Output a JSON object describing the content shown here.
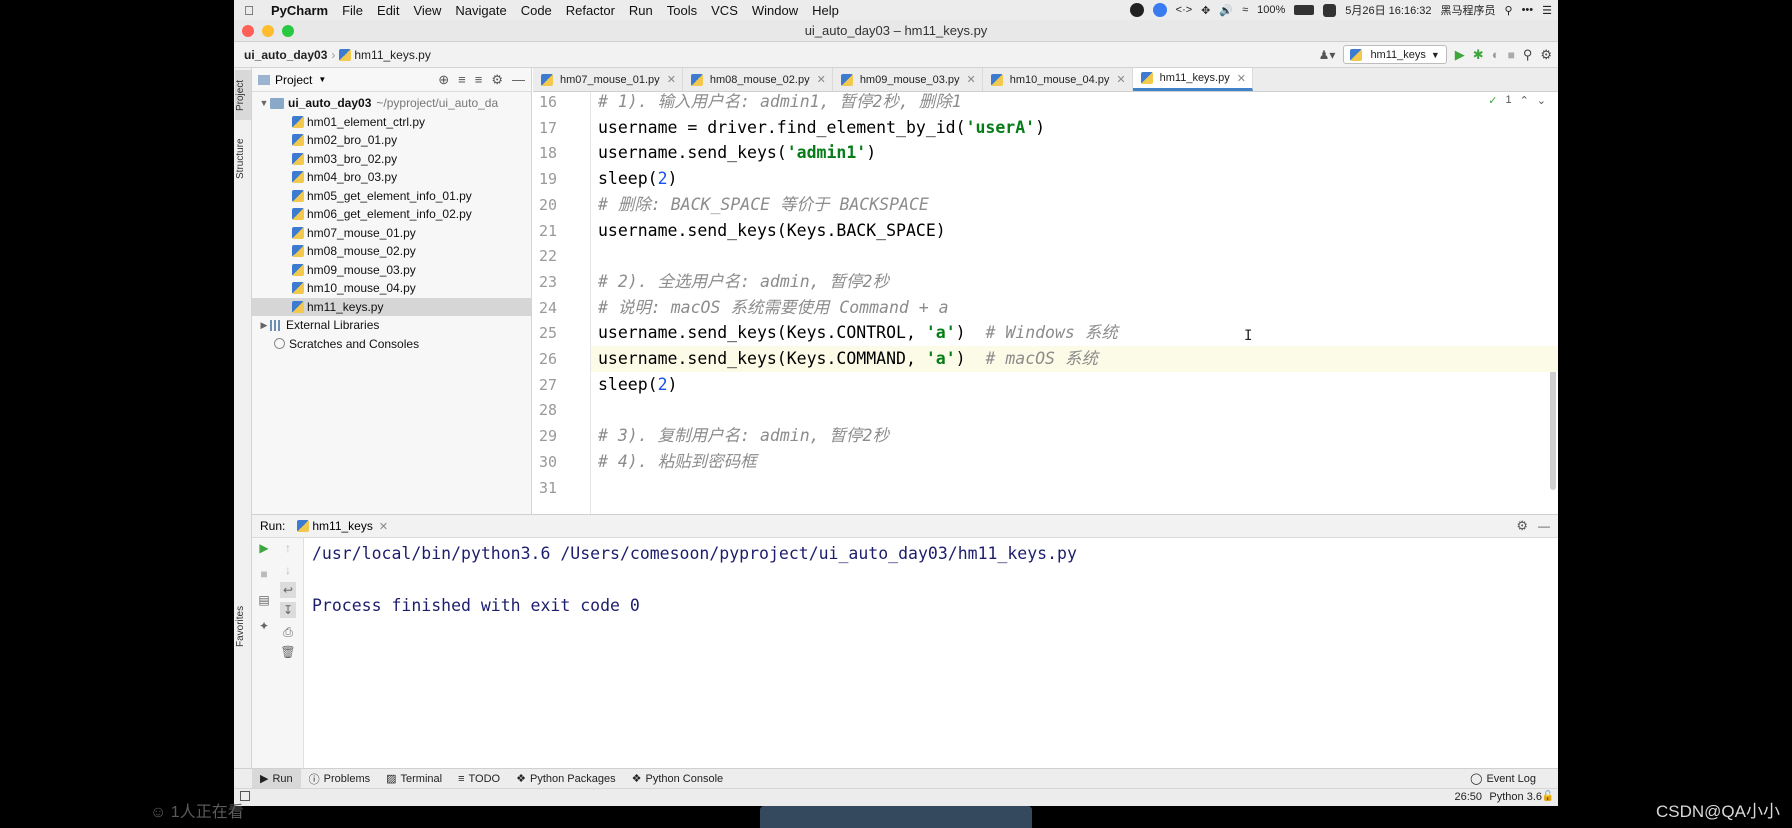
{
  "menubar": {
    "app_name": "PyCharm",
    "items": [
      "File",
      "Edit",
      "View",
      "Navigate",
      "Code",
      "Refactor",
      "Run",
      "Tools",
      "VCS",
      "Window",
      "Help"
    ],
    "battery": "100%",
    "clock": "5月26日 16:16:32",
    "user": "黑马程序员"
  },
  "window": {
    "title": "ui_auto_day03 – hm11_keys.py"
  },
  "navbar": {
    "project": "ui_auto_day03",
    "file": "hm11_keys.py",
    "run_config": "hm11_keys"
  },
  "project_panel": {
    "header": "Project",
    "side_tabs": {
      "project": "Project",
      "structure": "Structure",
      "favorites": "Favorites"
    },
    "root": {
      "name": "ui_auto_day03",
      "path": "~/pyproject/ui_auto_da"
    },
    "files": [
      "hm01_element_ctrl.py",
      "hm02_bro_01.py",
      "hm03_bro_02.py",
      "hm04_bro_03.py",
      "hm05_get_element_info_01.py",
      "hm06_get_element_info_02.py",
      "hm07_mouse_01.py",
      "hm08_mouse_02.py",
      "hm09_mouse_03.py",
      "hm10_mouse_04.py",
      "hm11_keys.py"
    ],
    "selected_file": "hm11_keys.py",
    "external_libraries": "External Libraries",
    "scratches": "Scratches and Consoles"
  },
  "editor": {
    "tabs": [
      "hm07_mouse_01.py",
      "hm08_mouse_02.py",
      "hm09_mouse_03.py",
      "hm10_mouse_04.py",
      "hm11_keys.py"
    ],
    "active_tab": "hm11_keys.py",
    "inspection_count": "1",
    "lines": [
      {
        "n": "16",
        "parts": [
          {
            "t": "# 1). 输入用户名: admin1, 暂停2秒, 删除1",
            "c": "cmt"
          }
        ]
      },
      {
        "n": "17",
        "parts": [
          {
            "t": "username = driver.find_element_by_id(",
            "c": ""
          },
          {
            "t": "'userA'",
            "c": "str"
          },
          {
            "t": ")",
            "c": ""
          }
        ]
      },
      {
        "n": "18",
        "parts": [
          {
            "t": "username.send_keys(",
            "c": ""
          },
          {
            "t": "'admin1'",
            "c": "str"
          },
          {
            "t": ")",
            "c": ""
          }
        ]
      },
      {
        "n": "19",
        "parts": [
          {
            "t": "sleep(",
            "c": ""
          },
          {
            "t": "2",
            "c": "num"
          },
          {
            "t": ")",
            "c": ""
          }
        ]
      },
      {
        "n": "20",
        "parts": [
          {
            "t": "# 删除: BACK_SPACE 等价于 BACKSPACE",
            "c": "cmt"
          }
        ]
      },
      {
        "n": "21",
        "parts": [
          {
            "t": "username.send_keys(Keys.BACK_SPACE)",
            "c": ""
          }
        ]
      },
      {
        "n": "22",
        "parts": []
      },
      {
        "n": "23",
        "parts": [
          {
            "t": "# 2). 全选用户名: admin, 暂停2秒",
            "c": "cmt"
          }
        ]
      },
      {
        "n": "24",
        "parts": [
          {
            "t": "# 说明: macOS 系统需要使用 Command + a",
            "c": "cmt"
          }
        ]
      },
      {
        "n": "25",
        "parts": [
          {
            "t": "username.send_keys(Keys.CONTROL, ",
            "c": ""
          },
          {
            "t": "'a'",
            "c": "str"
          },
          {
            "t": ")  ",
            "c": ""
          },
          {
            "t": "# Windows 系统",
            "c": "cmt"
          }
        ]
      },
      {
        "n": "26",
        "parts": [
          {
            "t": "username.send_keys(Keys.COMMAND, ",
            "c": ""
          },
          {
            "t": "'a'",
            "c": "str"
          },
          {
            "t": ")  ",
            "c": ""
          },
          {
            "t": "# macOS 系统",
            "c": "cmt"
          }
        ]
      },
      {
        "n": "27",
        "parts": [
          {
            "t": "sleep(",
            "c": ""
          },
          {
            "t": "2",
            "c": "num"
          },
          {
            "t": ")",
            "c": ""
          }
        ]
      },
      {
        "n": "28",
        "parts": []
      },
      {
        "n": "29",
        "parts": [
          {
            "t": "# 3). 复制用户名: admin, 暂停2秒",
            "c": "cmt"
          }
        ]
      },
      {
        "n": "30",
        "parts": [
          {
            "t": "# 4). 粘贴到密码框",
            "c": "cmt"
          }
        ]
      },
      {
        "n": "31",
        "parts": []
      }
    ],
    "current_line": "26"
  },
  "run_panel": {
    "label": "Run:",
    "tab": "hm11_keys",
    "output": [
      "/usr/local/bin/python3.6 /Users/comesoon/pyproject/ui_auto_day03/hm11_keys.py",
      "",
      "Process finished with exit code 0"
    ]
  },
  "tool_windows": [
    "Run",
    "Problems",
    "Terminal",
    "TODO",
    "Python Packages",
    "Python Console"
  ],
  "event_log": "Event Log",
  "status": {
    "position": "26:50",
    "interpreter": "Python 3.6"
  },
  "overlay": {
    "meeting": "1人正在看",
    "watermark": "CSDN@QA小小"
  },
  "colors": {
    "comment": "#8c8c8c",
    "string": "#067d17",
    "number": "#1750eb",
    "accent": "#4083c9",
    "run_green": "#3da63d"
  }
}
